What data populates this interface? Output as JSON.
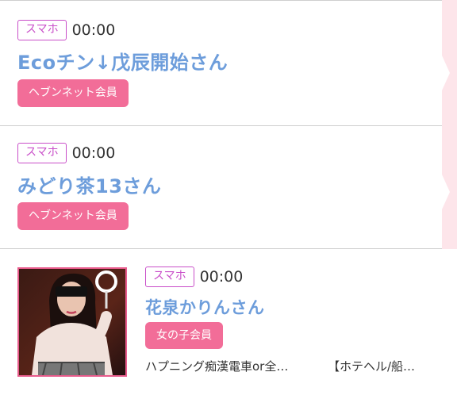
{
  "entries": [
    {
      "device": "スマホ",
      "time": "00:00",
      "name": "Ecoチン↓戊辰開始さん",
      "member_type": "ヘブンネット会員"
    },
    {
      "device": "スマホ",
      "time": "00:00",
      "name": "みどり茶13さん",
      "member_type": "ヘブンネット会員"
    },
    {
      "device": "スマホ",
      "time": "00:00",
      "name": "花泉かりんさん",
      "member_type": "女の子会員",
      "description_1": "ハプニング痴漢電車or全…",
      "description_2": "【ホテヘル/船…"
    }
  ],
  "colors": {
    "device_badge": "#c94fc9",
    "name": "#6d9ddb",
    "member_badge": "#f26d98",
    "rail": "#fde5ea"
  }
}
